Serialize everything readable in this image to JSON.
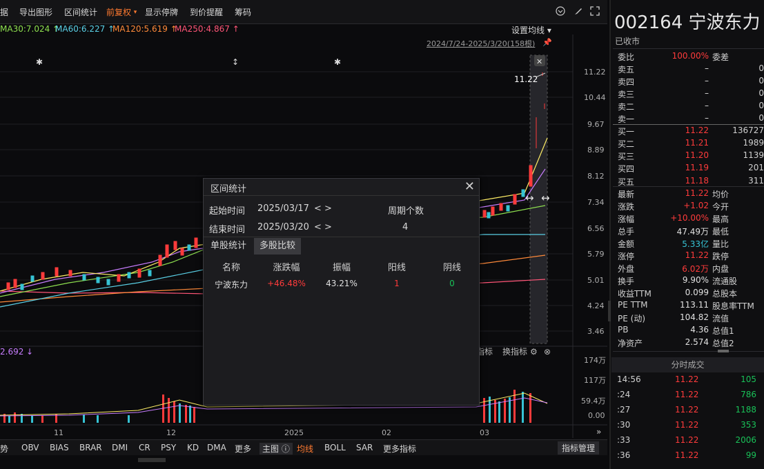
{
  "toolbar": {
    "items": [
      "据",
      "导出图形",
      "区间统计",
      "前复权",
      "显示停牌",
      "到价提醒",
      "筹码"
    ],
    "accent_item": "前复权"
  },
  "ma_legend": [
    {
      "label": "MA30:7.024",
      "color": "#8ee04f"
    },
    {
      "label": "MA60:6.227",
      "color": "#5ad0e6"
    },
    {
      "label": "MA120:5.619",
      "color": "#ff8a3a"
    },
    {
      "label": "MA250:4.867",
      "color": "#ff5577"
    }
  ],
  "set_ma_label": "设置均线",
  "range_info": "2024/7/24-2025/3/20(158根)",
  "last_price_label": "11.22",
  "y_axis": [
    "11.22",
    "10.44",
    "9.67",
    "8.89",
    "8.12",
    "7.34",
    "6.56",
    "5.79",
    "5.01",
    "4.24",
    "3.46"
  ],
  "vol_axis": [
    "174万",
    "117万",
    "59.4万",
    "0.00"
  ],
  "x_axis": [
    "11",
    "12",
    "2025",
    "02",
    "03"
  ],
  "vol_indicator_value": "2.692",
  "vol_controls": [
    "指标",
    "换指标"
  ],
  "bottom_bar": [
    "势",
    "OBV",
    "BIAS",
    "BRAR",
    "DMI",
    "CR",
    "PSY",
    "KD",
    "DMA",
    "更多",
    "主图",
    "均线",
    "BOLL",
    "SAR",
    "更多指标"
  ],
  "indicator_mgr": "指标管理",
  "popup": {
    "title": "区间统计",
    "start_label": "起始时间",
    "start_value": "2025/03/17",
    "end_label": "结束时间",
    "end_value": "2025/03/20",
    "arrows": "< >",
    "period_label": "周期个数",
    "period_value": "4",
    "tabs": [
      "单股统计",
      "多股比较"
    ],
    "headers": [
      "名称",
      "涨跌幅",
      "振幅",
      "阳线",
      "阴线"
    ],
    "row": {
      "name": "宁波东力",
      "change": "+46.48%",
      "amplitude": "43.21%",
      "up": "1",
      "down": "0"
    }
  },
  "stock": {
    "code_name": "002164 宁波东力",
    "status": "已收市"
  },
  "quotes": [
    {
      "l": "委比",
      "v": "100.00%",
      "vc": "red",
      "l2": "委差",
      "v2": ""
    },
    {
      "l": "卖五",
      "v": "–",
      "vc": "white",
      "l2": "",
      "v2": "0"
    },
    {
      "l": "卖四",
      "v": "–",
      "vc": "white",
      "l2": "",
      "v2": "0"
    },
    {
      "l": "卖三",
      "v": "–",
      "vc": "white",
      "l2": "",
      "v2": "0"
    },
    {
      "l": "卖二",
      "v": "–",
      "vc": "white",
      "l2": "",
      "v2": "0"
    },
    {
      "l": "卖一",
      "v": "–",
      "vc": "white",
      "l2": "",
      "v2": "0"
    },
    {
      "l": "买一",
      "v": "11.22",
      "vc": "red",
      "l2": "",
      "v2": "136727"
    },
    {
      "l": "买二",
      "v": "11.21",
      "vc": "red",
      "l2": "",
      "v2": "1989"
    },
    {
      "l": "买三",
      "v": "11.20",
      "vc": "red",
      "l2": "",
      "v2": "1139"
    },
    {
      "l": "买四",
      "v": "11.19",
      "vc": "red",
      "l2": "",
      "v2": "201"
    },
    {
      "l": "买五",
      "v": "11.18",
      "vc": "red",
      "l2": "",
      "v2": "311"
    },
    {
      "l": "最新",
      "v": "11.22",
      "vc": "red",
      "l2": "均价",
      "v2": ""
    },
    {
      "l": "涨跌",
      "v": "+1.02",
      "vc": "red",
      "l2": "今开",
      "v2": ""
    },
    {
      "l": "涨幅",
      "v": "+10.00%",
      "vc": "red",
      "l2": "最高",
      "v2": ""
    },
    {
      "l": "总手",
      "v": "47.49万",
      "vc": "white",
      "l2": "最低",
      "v2": ""
    },
    {
      "l": "金额",
      "v": "5.33亿",
      "vc": "cyan",
      "l2": "量比",
      "v2": ""
    },
    {
      "l": "涨停",
      "v": "11.22",
      "vc": "red",
      "l2": "跌停",
      "v2": ""
    },
    {
      "l": "外盘",
      "v": "6.02万",
      "vc": "red",
      "l2": "内盘",
      "v2": ""
    },
    {
      "l": "换手",
      "v": "9.90%",
      "vc": "white",
      "l2": "流通股",
      "v2": ""
    },
    {
      "l": "收益TTM",
      "v": "0.099",
      "vc": "white",
      "l2": "总股本",
      "v2": ""
    },
    {
      "l": "PE TTM",
      "v": "113.11",
      "vc": "white",
      "l2": "股息率TTM",
      "v2": ""
    },
    {
      "l": "PE (动)",
      "v": "104.82",
      "vc": "white",
      "l2": "流值",
      "v2": ""
    },
    {
      "l": "PB",
      "v": "4.36",
      "vc": "white",
      "l2": "总值1",
      "v2": ""
    },
    {
      "l": "净资产",
      "v": "2.574",
      "vc": "white",
      "l2": "总值2",
      "v2": ""
    }
  ],
  "ticks_header": "分时成交",
  "ticks": [
    {
      "t": "14:56",
      "p": "11.22",
      "vol": "105",
      "vc": "green"
    },
    {
      "t": ":24",
      "p": "11.22",
      "vol": "786",
      "vc": "green"
    },
    {
      "t": ":27",
      "p": "11.22",
      "vol": "1188",
      "vc": "green"
    },
    {
      "t": ":30",
      "p": "11.22",
      "vol": "353",
      "vc": "green"
    },
    {
      "t": ":33",
      "p": "11.22",
      "vol": "2006",
      "vc": "green"
    },
    {
      "t": ":36",
      "p": "11.22",
      "vol": "99",
      "vc": "green"
    }
  ]
}
